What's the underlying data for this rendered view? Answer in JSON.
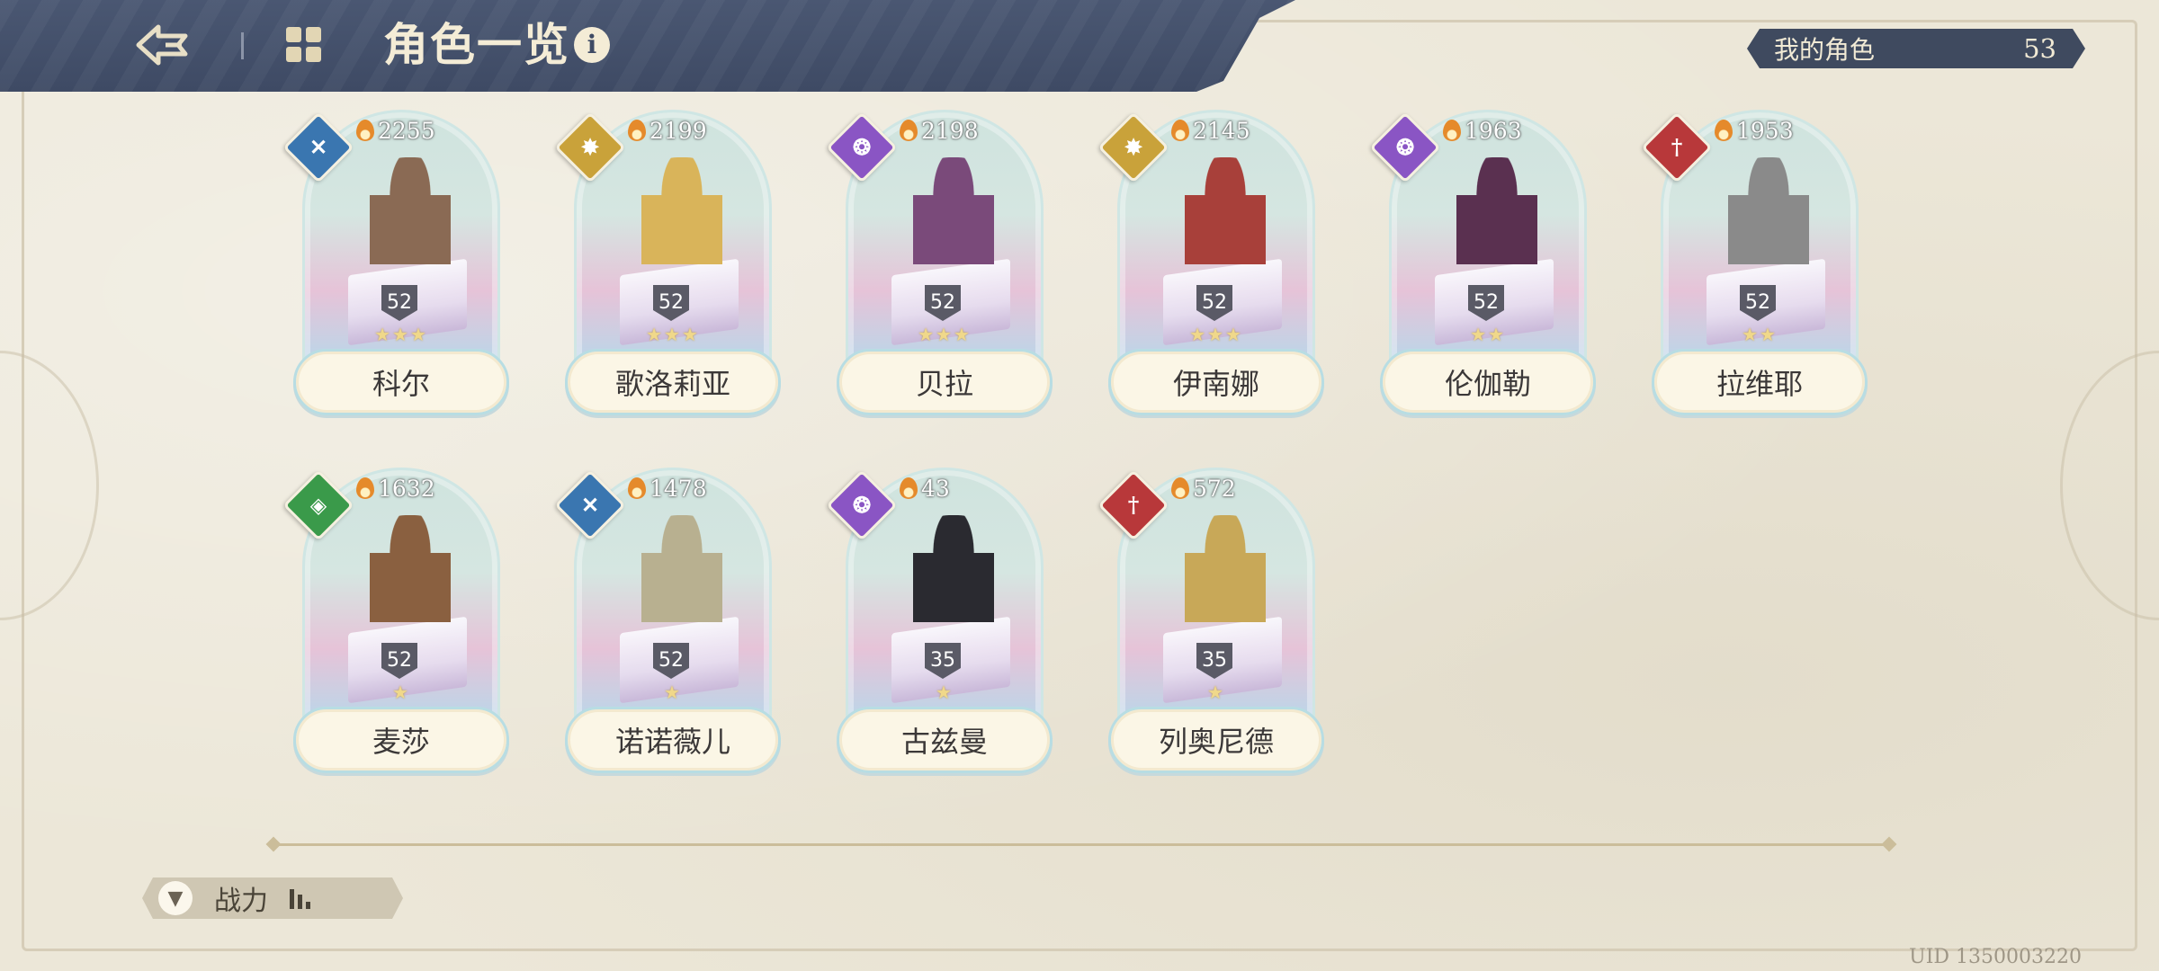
{
  "header": {
    "title": "角色一览",
    "back_icon": "back-arrow-icon",
    "menu_icon": "grid-menu-icon",
    "info_icon": "i"
  },
  "my_characters": {
    "label": "我的角色",
    "count": "53"
  },
  "characters": [
    {
      "name": "科尔",
      "power": "2255",
      "level": "52",
      "stars": "★★★",
      "element_color": "#3a76b0",
      "element_glyph": "✕",
      "figure_color": "#8a6a54"
    },
    {
      "name": "歌洛莉亚",
      "power": "2199",
      "level": "52",
      "stars": "★★★",
      "element_color": "#c9a23a",
      "element_glyph": "✸",
      "figure_color": "#d9b45a"
    },
    {
      "name": "贝拉",
      "power": "2198",
      "level": "52",
      "stars": "★★★",
      "element_color": "#8a55c4",
      "element_glyph": "❂",
      "figure_color": "#7a4a7a"
    },
    {
      "name": "伊南娜",
      "power": "2145",
      "level": "52",
      "stars": "★★★",
      "element_color": "#c9a23a",
      "element_glyph": "✸",
      "figure_color": "#a8403a"
    },
    {
      "name": "伦伽勒",
      "power": "1963",
      "level": "52",
      "stars": "★★",
      "element_color": "#8a55c4",
      "element_glyph": "❂",
      "figure_color": "#5a3050"
    },
    {
      "name": "拉维耶",
      "power": "1953",
      "level": "52",
      "stars": "★★",
      "element_color": "#b8383a",
      "element_glyph": "†",
      "figure_color": "#8a8a8a"
    },
    {
      "name": "麦莎",
      "power": "1632",
      "level": "52",
      "stars": "★",
      "element_color": "#3a9a4a",
      "element_glyph": "◈",
      "figure_color": "#8a6040"
    },
    {
      "name": "诺诺薇儿",
      "power": "1478",
      "level": "52",
      "stars": "★",
      "element_color": "#3a76b0",
      "element_glyph": "✕",
      "figure_color": "#b8b090"
    },
    {
      "name": "古兹曼",
      "power": "43",
      "level": "35",
      "stars": "★",
      "element_color": "#8a55c4",
      "element_glyph": "❂",
      "figure_color": "#2a2a30"
    },
    {
      "name": "列奥尼德",
      "power": "572",
      "level": "35",
      "stars": "★",
      "element_color": "#b8383a",
      "element_glyph": "†",
      "figure_color": "#c8a858"
    }
  ],
  "sort_button": {
    "label": "战力",
    "icon": "filter-icon"
  },
  "uid": "UID 1350003220"
}
